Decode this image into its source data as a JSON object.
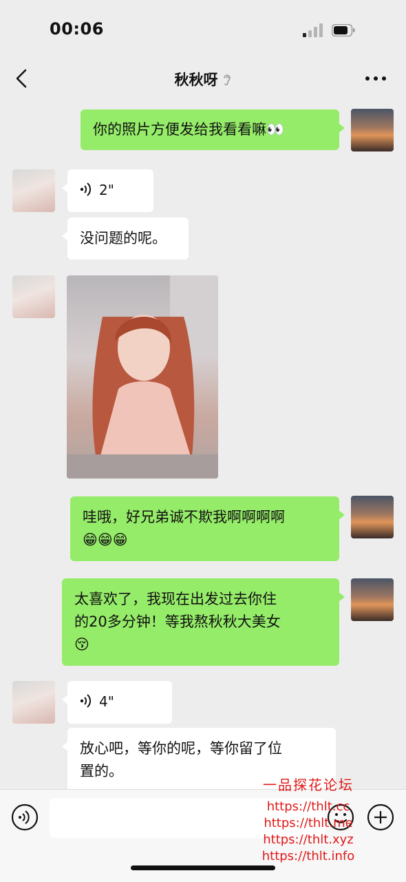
{
  "status_bar": {
    "time": "00:06"
  },
  "header": {
    "contact_name": "秋秋呀"
  },
  "messages": [
    {
      "from": "me",
      "type": "text",
      "text": "你的照片方便发给我看看嘛👀"
    },
    {
      "from": "contact",
      "type": "voice",
      "duration": "2\""
    },
    {
      "from": "contact",
      "type": "text",
      "text": "没问题的呢。"
    },
    {
      "from": "contact",
      "type": "image"
    },
    {
      "from": "me",
      "type": "text",
      "lines": [
        "哇哦，好兄弟诚不欺我啊啊啊啊",
        "😁😁😁"
      ]
    },
    {
      "from": "me",
      "type": "text",
      "lines": [
        "太喜欢了，我现在出发过去你住",
        "的20多分钟！等我熬秋秋大美女",
        "😚"
      ]
    },
    {
      "from": "contact",
      "type": "voice",
      "duration": "4\""
    },
    {
      "from": "contact",
      "type": "text",
      "lines": [
        "放心吧，等你的呢，等你留了位",
        "置的。"
      ]
    }
  ],
  "watermark": {
    "title": "一品探花论坛",
    "urls": [
      "https://thlt.cc",
      "https://thlt.me",
      "https://thlt.xyz",
      "https://thlt.info"
    ]
  },
  "colors": {
    "sent_bubble": "#95ec69",
    "received_bubble": "#ffffff",
    "background": "#ededed",
    "watermark": "#e01818"
  },
  "icons": [
    "signal-icon",
    "battery-icon",
    "back-icon",
    "ear-icon",
    "more-icon",
    "voice-wave-icon",
    "voice-input-icon",
    "emoji-icon",
    "plus-icon"
  ]
}
